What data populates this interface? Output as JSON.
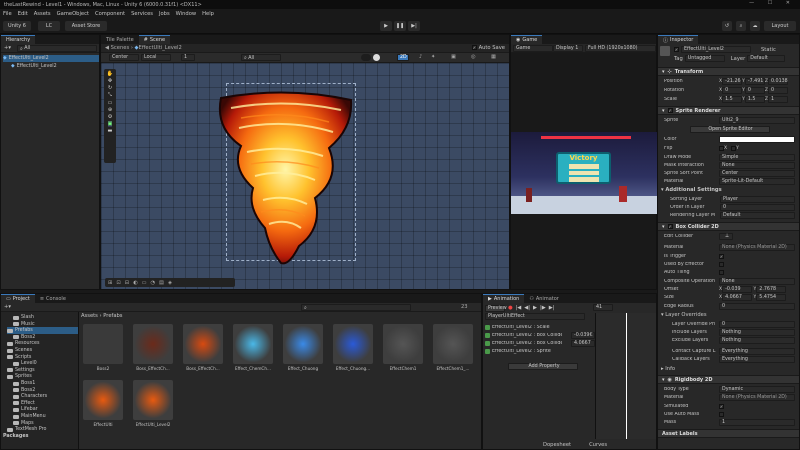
{
  "window": {
    "title": "theLastRewind - Level1 - Windows, Mac, Linux - Unity 6 (6000.0.31f1) <DX11>"
  },
  "menu": [
    "File",
    "Edit",
    "Assets",
    "GameObject",
    "Component",
    "Services",
    "Jobs",
    "Window",
    "Help"
  ],
  "toolbar": {
    "account": "Unity 6",
    "cloud": "LC",
    "asset_store": "Asset Store",
    "layout": "Layout"
  },
  "hierarchy": {
    "tab": "Hierarchy",
    "search": "All",
    "items": [
      "EffectUlti_Level2",
      "EffectUlti_Level2"
    ]
  },
  "scene_tabs": [
    "Tile Palette",
    "Scene"
  ],
  "scene": {
    "breadcrumb_a": "Scenes",
    "breadcrumb_b": "EffectUlti_Level2",
    "pivot": "Center",
    "space": "Local",
    "snap": "1",
    "mode_2d": "2D",
    "auto_save": "Auto Save"
  },
  "game": {
    "tab": "Game",
    "mode": "Game",
    "display": "Display 1",
    "resolution": "Full HD (1920x1080)",
    "victory": "Victory"
  },
  "project": {
    "tabs": [
      "Project",
      "Console"
    ],
    "breadcrumb_a": "Assets",
    "breadcrumb_b": "Prefabs",
    "count": "23",
    "tree": [
      "Slash",
      "Music",
      "Prefabs",
      "Boss2",
      "Resources",
      "Scenes",
      "Scripts",
      "Level0",
      "Settings",
      "Sprites",
      "Boss1",
      "Boss2",
      "Characters",
      "Effect",
      "Lifebar",
      "MainMenu",
      "Maps",
      "TextMesh Pro"
    ],
    "packages": "Packages",
    "assets": [
      "Boss2",
      "Boss_EffectCh...",
      "Boss_EffectCh...",
      "Effect_ChemCh...",
      "Effect_Chuong",
      "Effect_Chuong...",
      "EffectChem1",
      "EffectChem1_...",
      "EffectUlti",
      "EffectUlti_Level2"
    ]
  },
  "animation": {
    "tabs": [
      "Animation",
      "Animator"
    ],
    "preview": "Preview",
    "frame": "41",
    "clip": "PlayerUltiEffect",
    "props": [
      {
        "name": "EffectUlti_Level2 : Scale",
        "value": ""
      },
      {
        "name": "EffectUlti_Level2 : Box Collide",
        "value": "-0.039€"
      },
      {
        "name": "EffectUlti_Level2 : Box Collide",
        "value": "4.0667"
      },
      {
        "name": "EffectUlti_Level2 : Sprite",
        "value": ""
      }
    ],
    "add_property": "Add Property",
    "dopesheet": "Dopesheet",
    "curves": "Curves",
    "times": [
      "0:00",
      "0:10",
      "0:20",
      "0:30"
    ]
  },
  "inspector": {
    "tab": "Inspector",
    "name": "EffectUlti_Level2",
    "static": "Static",
    "tag_label": "Tag",
    "tag": "Untagged",
    "layer_label": "Layer",
    "layer": "Default",
    "transform": {
      "title": "Transform",
      "position": {
        "label": "Position",
        "x": "-21.26",
        "y": "-7.491",
        "z": "0.0138"
      },
      "rotation": {
        "label": "Rotation",
        "x": "0",
        "y": "0",
        "z": "0"
      },
      "scale": {
        "label": "Scale",
        "x": "1.5",
        "y": "1.5",
        "z": "1"
      }
    },
    "sprite_renderer": {
      "title": "Sprite Renderer",
      "sprite_label": "Sprite",
      "sprite": "Ulti2_9",
      "open_editor": "Open Sprite Editor",
      "color": "Color",
      "flip": "Flip",
      "x": "X",
      "y": "Y",
      "draw_mode_label": "Draw Mode",
      "draw_mode": "Simple",
      "mask_label": "Mask Interaction",
      "mask": "None",
      "sort_point_label": "Sprite Sort Point",
      "sort_point": "Center",
      "material_label": "Material",
      "material": "Sprite-Lit-Default",
      "additional": "Additional Settings",
      "sorting_layer_label": "Sorting Layer",
      "sorting_layer": "Player",
      "order_label": "Order in Layer",
      "order": "0",
      "rendering_label": "Rendering Layer M",
      "rendering": "Default"
    },
    "box_collider": {
      "title": "Box Collider 2D",
      "edit_label": "Edit Collider",
      "material_label": "Material",
      "material": "None (Physics Material 2D)",
      "trigger": "Is Trigger",
      "effector": "Used By Effector",
      "tiling": "Auto Tiling",
      "composite_label": "Composite Operation",
      "composite": "None",
      "offset": "Offset",
      "offset_x": "-0.039",
      "offset_y": "2.7678",
      "size": "Size",
      "size_x": "4.0667",
      "size_y": "5.4754",
      "edge_label": "Edge Radius",
      "edge": "0",
      "layer_overrides": "Layer Overrides",
      "priority_label": "Layer Override Pri",
      "priority": "0",
      "include_label": "Include Layers",
      "include": "Nothing",
      "exclude_label": "Exclude Layers",
      "exclude": "Nothing",
      "contact_label": "Contact Capture L",
      "contact": "Everything",
      "callback_label": "Callback Layers",
      "callback": "Everything",
      "info": "Info"
    },
    "rigidbody": {
      "title": "Rigidbody 2D",
      "body_label": "Body Type",
      "body": "Dynamic",
      "material_label": "Material",
      "material": "None (Physics Material 2D)",
      "simulated": "Simulated",
      "auto_mass": "Use Auto Mass",
      "mass_label": "Mass",
      "mass": "1"
    },
    "asset_labels": "Asset Labels"
  }
}
